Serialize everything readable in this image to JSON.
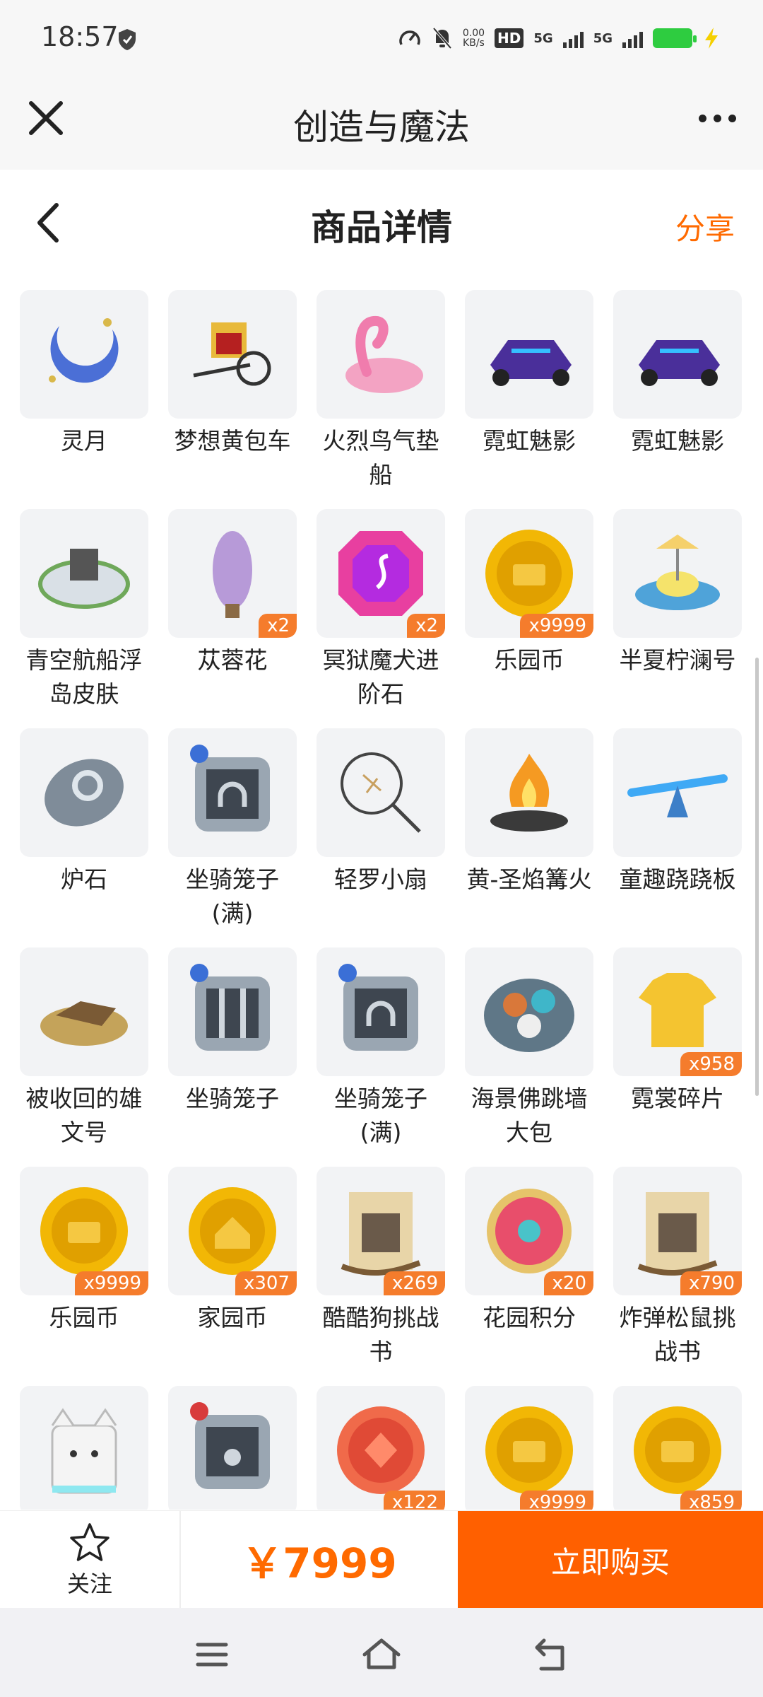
{
  "status": {
    "time": "18:57",
    "net_speed_top": "0.00",
    "net_speed_unit": "KB/s",
    "hd": "HD",
    "sig1": "5G",
    "sig2": "5G"
  },
  "app": {
    "title": "创造与魔法"
  },
  "page": {
    "title": "商品详情",
    "share": "分享"
  },
  "colors": {
    "accent": "#ff6a00",
    "badge": "#f57c2c",
    "buy": "#ff6000"
  },
  "items": [
    {
      "name": "灵月",
      "qty": "",
      "icon": "crescent-moon"
    },
    {
      "name": "梦想黄包车",
      "qty": "",
      "icon": "rickshaw"
    },
    {
      "name": "火烈鸟气垫船",
      "qty": "",
      "icon": "flamingo-float"
    },
    {
      "name": "霓虹魅影",
      "qty": "",
      "icon": "neon-car"
    },
    {
      "name": "霓虹魅影",
      "qty": "",
      "icon": "neon-car"
    },
    {
      "name": "青空航船浮岛皮肤",
      "qty": "",
      "icon": "floating-island"
    },
    {
      "name": "苁蓉花",
      "qty": "x2",
      "icon": "purple-flower"
    },
    {
      "name": "冥狱魔犬进阶石",
      "qty": "x2",
      "icon": "gem"
    },
    {
      "name": "乐园币",
      "qty": "x9999",
      "icon": "gold-coin"
    },
    {
      "name": "半夏柠澜号",
      "qty": "",
      "icon": "lemon-boat"
    },
    {
      "name": "炉石",
      "qty": "",
      "icon": "hearthstone"
    },
    {
      "name": "坐骑笼子(满)",
      "qty": "",
      "icon": "cage-full"
    },
    {
      "name": "轻罗小扇",
      "qty": "",
      "icon": "fan"
    },
    {
      "name": "黄-圣焰篝火",
      "qty": "",
      "icon": "bonfire"
    },
    {
      "name": "童趣跷跷板",
      "qty": "",
      "icon": "seesaw"
    },
    {
      "name": "被收回的雄文号",
      "qty": "",
      "icon": "wrecked-ship"
    },
    {
      "name": "坐骑笼子",
      "qty": "",
      "icon": "cage-empty"
    },
    {
      "name": "坐骑笼子(满)",
      "qty": "",
      "icon": "cage-full"
    },
    {
      "name": "海景佛跳墙大包",
      "qty": "",
      "icon": "seafood-plate"
    },
    {
      "name": "霓裳碎片",
      "qty": "x958",
      "icon": "shirt"
    },
    {
      "name": "乐园币",
      "qty": "x9999",
      "icon": "gold-coin"
    },
    {
      "name": "家园币",
      "qty": "x307",
      "icon": "home-coin"
    },
    {
      "name": "酷酷狗挑战书",
      "qty": "x269",
      "icon": "wanted-scroll"
    },
    {
      "name": "花园积分",
      "qty": "x20",
      "icon": "flower-badge"
    },
    {
      "name": "炸弹松鼠挑战书",
      "qty": "x790",
      "icon": "wanted-scroll"
    },
    {
      "name": "",
      "qty": "",
      "icon": "cat-block"
    },
    {
      "name": "",
      "qty": "",
      "icon": "pet-cage"
    },
    {
      "name": "",
      "qty": "x122",
      "icon": "red-coin"
    },
    {
      "name": "",
      "qty": "x9999",
      "icon": "gold-coin"
    },
    {
      "name": "",
      "qty": "x859",
      "icon": "gold-coin"
    }
  ],
  "bottom": {
    "follow": "关注",
    "price": "￥7999",
    "buy": "立即购买"
  }
}
